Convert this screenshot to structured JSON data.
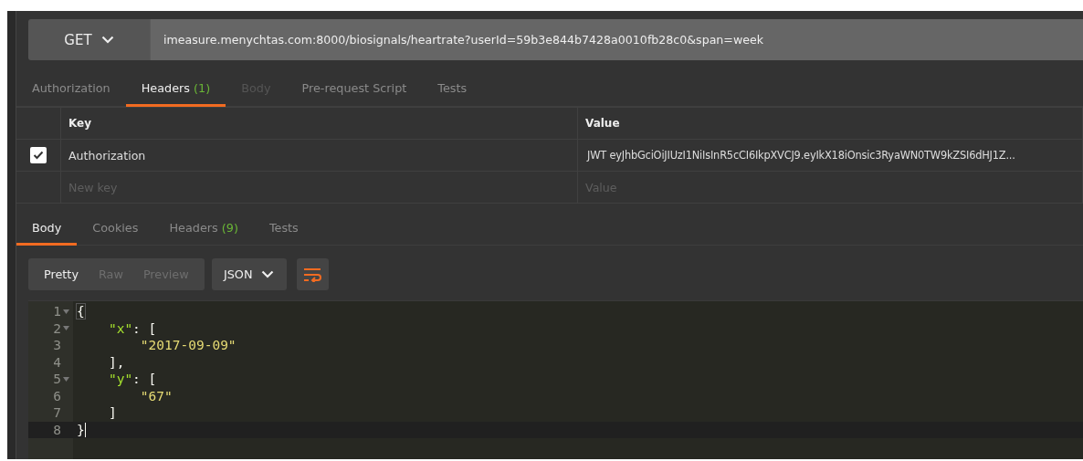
{
  "request": {
    "method": "GET",
    "url": "imeasure.menychtas.com:8000/biosignals/heartrate?userId=59b3e844b7428a0010fb28c0&span=week"
  },
  "request_tabs": [
    {
      "label": "Authorization",
      "selected": false,
      "disabled": false
    },
    {
      "label": "Headers",
      "count": "(1)",
      "selected": true,
      "disabled": false
    },
    {
      "label": "Body",
      "selected": false,
      "disabled": true
    },
    {
      "label": "Pre-request Script",
      "selected": false,
      "disabled": false
    },
    {
      "label": "Tests",
      "selected": false,
      "disabled": false
    }
  ],
  "headers_table": {
    "columns": [
      "Key",
      "Value"
    ],
    "rows": [
      {
        "checked": true,
        "key": "Authorization",
        "value": "JWT eyJhbGciOiJIUzI1NiIsInR5cCI6IkpXVCJ9.eyIkX18iOnsic3RyaWN0TW9kZSI6dHJ1Z..."
      }
    ],
    "new_row": {
      "key_placeholder": "New key",
      "value_placeholder": "Value"
    }
  },
  "response_tabs": [
    {
      "label": "Body",
      "selected": true
    },
    {
      "label": "Cookies",
      "selected": false
    },
    {
      "label": "Headers",
      "count": "(9)",
      "selected": false
    },
    {
      "label": "Tests",
      "selected": false
    }
  ],
  "view_modes": [
    {
      "label": "Pretty",
      "selected": true
    },
    {
      "label": "Raw",
      "selected": false
    },
    {
      "label": "Preview",
      "selected": false
    }
  ],
  "format": "JSON",
  "code_lines": [
    {
      "number": "1",
      "foldable": true,
      "current": false,
      "tokens": [
        {
          "text": "{",
          "kind": "bracket-match"
        }
      ]
    },
    {
      "number": "2",
      "foldable": true,
      "current": false,
      "tokens": [
        {
          "text": "    \"x\"",
          "kind": "key"
        },
        {
          "text": ": [",
          "kind": "punct"
        }
      ]
    },
    {
      "number": "3",
      "foldable": false,
      "current": false,
      "tokens": [
        {
          "text": "        \"2017-09-09\"",
          "kind": "string"
        }
      ]
    },
    {
      "number": "4",
      "foldable": false,
      "current": false,
      "tokens": [
        {
          "text": "    ],",
          "kind": "punct"
        }
      ]
    },
    {
      "number": "5",
      "foldable": true,
      "current": false,
      "tokens": [
        {
          "text": "    \"y\"",
          "kind": "key"
        },
        {
          "text": ": [",
          "kind": "punct"
        }
      ]
    },
    {
      "number": "6",
      "foldable": false,
      "current": false,
      "tokens": [
        {
          "text": "        \"67\"",
          "kind": "string"
        }
      ]
    },
    {
      "number": "7",
      "foldable": false,
      "current": false,
      "tokens": [
        {
          "text": "    ]",
          "kind": "punct"
        }
      ]
    },
    {
      "number": "8",
      "foldable": false,
      "current": true,
      "tokens": [
        {
          "text": "}",
          "kind": "punct"
        }
      ]
    }
  ]
}
